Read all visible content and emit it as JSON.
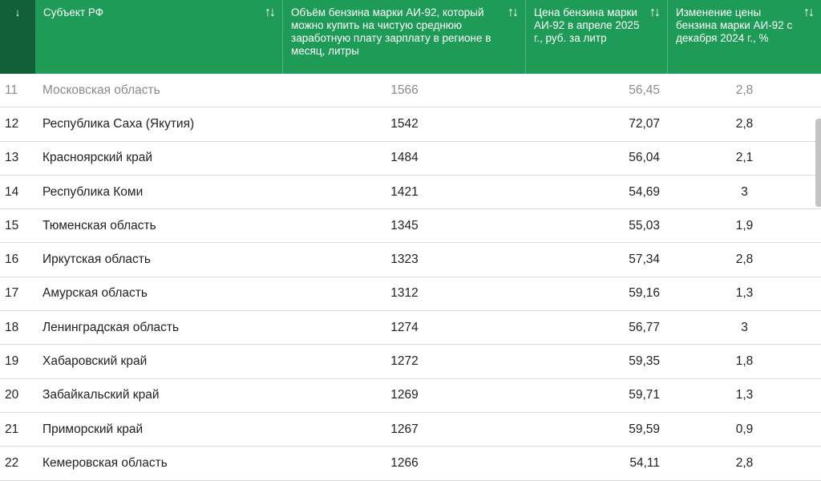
{
  "header": {
    "rank_sort": "↓",
    "sort_glyph": "↑↓",
    "columns": [
      "Субъект РФ",
      "Объём бензина марки АИ-92, который можно купить на чистую среднюю заработную плату зарплату в регионе в месяц, литры",
      "Цена бензина марки АИ-92 в апреле 2025 г., руб. за литр",
      "Изменение цены бензина марки АИ-92 с декабря 2024 г., %"
    ]
  },
  "rows": [
    {
      "rank": "11",
      "region": "Московская область",
      "volume": "1566",
      "price": "56,45",
      "change": "2,8"
    },
    {
      "rank": "12",
      "region": "Республика Саха (Якутия)",
      "volume": "1542",
      "price": "72,07",
      "change": "2,8"
    },
    {
      "rank": "13",
      "region": "Красноярский край",
      "volume": "1484",
      "price": "56,04",
      "change": "2,1"
    },
    {
      "rank": "14",
      "region": "Республика Коми",
      "volume": "1421",
      "price": "54,69",
      "change": "3"
    },
    {
      "rank": "15",
      "region": "Тюменская область",
      "volume": "1345",
      "price": "55,03",
      "change": "1,9"
    },
    {
      "rank": "16",
      "region": "Иркутская область",
      "volume": "1323",
      "price": "57,34",
      "change": "2,8"
    },
    {
      "rank": "17",
      "region": "Амурская область",
      "volume": "1312",
      "price": "59,16",
      "change": "1,3"
    },
    {
      "rank": "18",
      "region": "Ленинградская область",
      "volume": "1274",
      "price": "56,77",
      "change": "3"
    },
    {
      "rank": "19",
      "region": "Хабаровский край",
      "volume": "1272",
      "price": "59,35",
      "change": "1,8"
    },
    {
      "rank": "20",
      "region": "Забайкальский край",
      "volume": "1269",
      "price": "59,71",
      "change": "1,3"
    },
    {
      "rank": "21",
      "region": "Приморский край",
      "volume": "1267",
      "price": "59,59",
      "change": "0,9"
    },
    {
      "rank": "22",
      "region": "Кемеровская область",
      "volume": "1266",
      "price": "54,11",
      "change": "2,8"
    }
  ]
}
